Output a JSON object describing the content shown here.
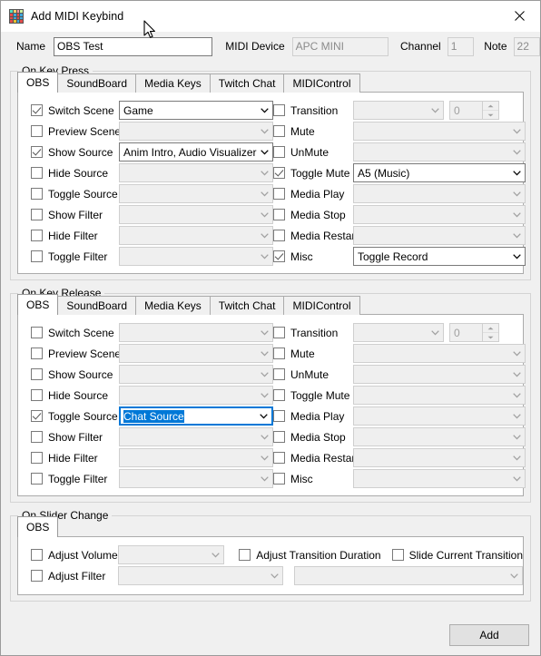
{
  "window": {
    "title": "Add MIDI Keybind",
    "icon": "midi-grid-icon",
    "close_label": "✕",
    "accent_color": "#0078d7",
    "icon_colors": [
      "#52e0c4",
      "#ffd36b",
      "#ff9aa2",
      "#c9f0a0",
      "#e34b4b",
      "#3fa7dc",
      "#e34b4b",
      "#3fa7dc",
      "#e34b4b",
      "#3fa7dc",
      "#e34b4b",
      "#3fa7dc",
      "#e34b4b",
      "#e8c230",
      "#3fa7dc",
      "#e34b4b"
    ]
  },
  "header": {
    "name_label": "Name",
    "name_value": "OBS Test",
    "device_label": "MIDI Device",
    "device_value": "APC MINI",
    "channel_label": "Channel",
    "channel_value": "1",
    "note_label": "Note",
    "note_value": "22"
  },
  "tabs": [
    "OBS",
    "SoundBoard",
    "Media Keys",
    "Twitch Chat",
    "MIDIControl"
  ],
  "slider_tabs": [
    "OBS"
  ],
  "sections": [
    {
      "title": "On Key Press",
      "active_tab": "OBS",
      "left": [
        {
          "label": "Switch Scene",
          "checked": true,
          "value": "Game",
          "enabled": true,
          "focused": false
        },
        {
          "label": "Preview Scene",
          "checked": false,
          "value": "",
          "enabled": false,
          "focused": false
        },
        {
          "label": "Show Source",
          "checked": true,
          "value": "Anim Intro, Audio Visualizer Intro",
          "enabled": true,
          "focused": false
        },
        {
          "label": "Hide Source",
          "checked": false,
          "value": "",
          "enabled": false,
          "focused": false
        },
        {
          "label": "Toggle Source",
          "checked": false,
          "value": "",
          "enabled": false,
          "focused": false
        },
        {
          "label": "Show Filter",
          "checked": false,
          "value": "",
          "enabled": false,
          "focused": false
        },
        {
          "label": "Hide Filter",
          "checked": false,
          "value": "",
          "enabled": false,
          "focused": false
        },
        {
          "label": "Toggle Filter",
          "checked": false,
          "value": "",
          "enabled": false,
          "focused": false
        }
      ],
      "right": [
        {
          "label": "Transition",
          "checked": false,
          "value": "",
          "enabled": false,
          "focused": false,
          "spin": "0"
        },
        {
          "label": "Mute",
          "checked": false,
          "value": "",
          "enabled": false,
          "focused": false
        },
        {
          "label": "UnMute",
          "checked": false,
          "value": "",
          "enabled": false,
          "focused": false
        },
        {
          "label": "Toggle Mute",
          "checked": true,
          "value": "A5 (Music)",
          "enabled": true,
          "focused": false
        },
        {
          "label": "Media Play",
          "checked": false,
          "value": "",
          "enabled": false,
          "focused": false
        },
        {
          "label": "Media Stop",
          "checked": false,
          "value": "",
          "enabled": false,
          "focused": false
        },
        {
          "label": "Media Restart",
          "checked": false,
          "value": "",
          "enabled": false,
          "focused": false
        },
        {
          "label": "Misc",
          "checked": true,
          "value": "Toggle Record",
          "enabled": true,
          "focused": false
        }
      ]
    },
    {
      "title": "On Key Release",
      "active_tab": "OBS",
      "left": [
        {
          "label": "Switch Scene",
          "checked": false,
          "value": "",
          "enabled": false,
          "focused": false
        },
        {
          "label": "Preview Scene",
          "checked": false,
          "value": "",
          "enabled": false,
          "focused": false
        },
        {
          "label": "Show Source",
          "checked": false,
          "value": "",
          "enabled": false,
          "focused": false
        },
        {
          "label": "Hide Source",
          "checked": false,
          "value": "",
          "enabled": false,
          "focused": false
        },
        {
          "label": "Toggle Source",
          "checked": true,
          "value": "Chat Source",
          "enabled": true,
          "focused": true
        },
        {
          "label": "Show Filter",
          "checked": false,
          "value": "",
          "enabled": false,
          "focused": false
        },
        {
          "label": "Hide Filter",
          "checked": false,
          "value": "",
          "enabled": false,
          "focused": false
        },
        {
          "label": "Toggle Filter",
          "checked": false,
          "value": "",
          "enabled": false,
          "focused": false
        }
      ],
      "right": [
        {
          "label": "Transition",
          "checked": false,
          "value": "",
          "enabled": false,
          "focused": false,
          "spin": "0"
        },
        {
          "label": "Mute",
          "checked": false,
          "value": "",
          "enabled": false,
          "focused": false
        },
        {
          "label": "UnMute",
          "checked": false,
          "value": "",
          "enabled": false,
          "focused": false
        },
        {
          "label": "Toggle Mute",
          "checked": false,
          "value": "",
          "enabled": false,
          "focused": false
        },
        {
          "label": "Media Play",
          "checked": false,
          "value": "",
          "enabled": false,
          "focused": false
        },
        {
          "label": "Media Stop",
          "checked": false,
          "value": "",
          "enabled": false,
          "focused": false
        },
        {
          "label": "Media Restart",
          "checked": false,
          "value": "",
          "enabled": false,
          "focused": false
        },
        {
          "label": "Misc",
          "checked": false,
          "value": "",
          "enabled": false,
          "focused": false
        }
      ]
    }
  ],
  "slider_section": {
    "title": "On Slider Change",
    "active_tab": "OBS",
    "adjust_volume": {
      "label": "Adjust Volume",
      "checked": false,
      "value": "",
      "enabled": false
    },
    "adjust_filter": {
      "label": "Adjust Filter",
      "checked": false,
      "value": "",
      "enabled": false
    },
    "adjust_filter_second": {
      "value": "",
      "enabled": false
    },
    "adjust_transition_duration": {
      "label": "Adjust Transition Duration",
      "checked": false
    },
    "slide_current_transition": {
      "label": "Slide Current Transition",
      "checked": false
    }
  },
  "footer": {
    "add_label": "Add"
  }
}
